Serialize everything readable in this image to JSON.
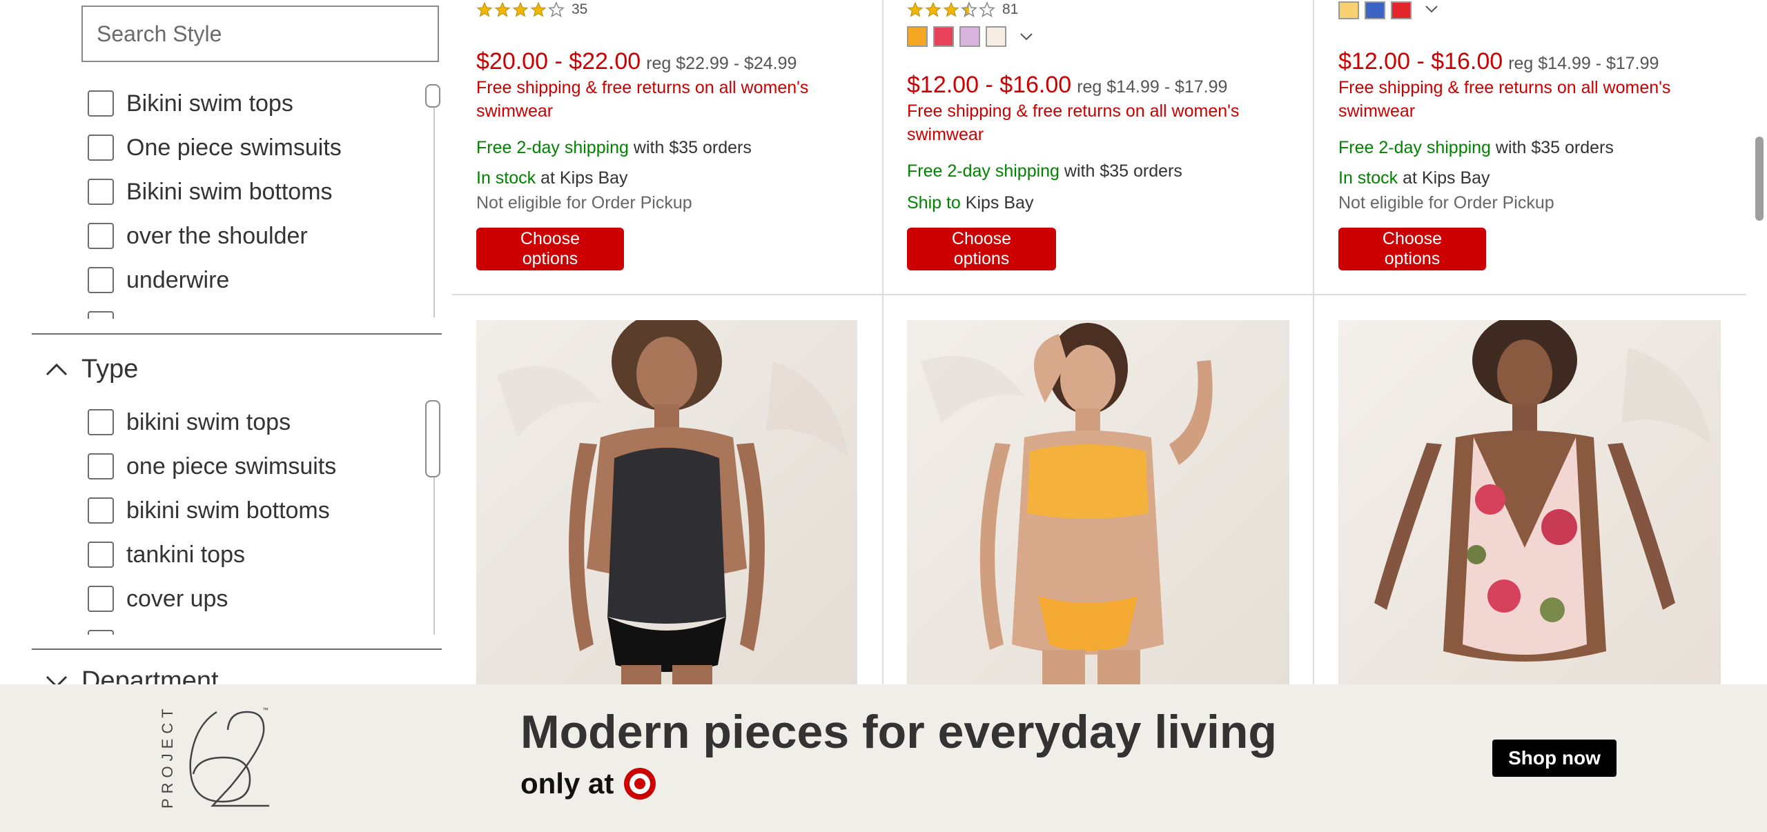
{
  "sidebar": {
    "search_placeholder": "Search Style",
    "style_items": [
      "Bikini swim tops",
      "One piece swimsuits",
      "Bikini swim bottoms",
      "over the shoulder",
      "underwire"
    ],
    "type_section_title": "Type",
    "type_items": [
      "bikini swim tops",
      "one piece swimsuits",
      "bikini swim bottoms",
      "tankini tops",
      "cover ups"
    ],
    "department_section_title": "Department"
  },
  "products_top": [
    {
      "rating_stars": 4,
      "rating_count": "35",
      "price": "$20.00 - $22.00",
      "reg_price": "reg $22.99 - $24.99",
      "promo": "Free shipping & free returns on all women's swimwear",
      "shipping_highlight": "Free 2-day shipping",
      "shipping_rest": " with $35 orders",
      "stock_status": "In stock",
      "stock_rest": " at Kips Bay",
      "pickup_note": "Not eligible for Order Pickup",
      "button_label": "Choose options"
    },
    {
      "rating_stars": 3.5,
      "rating_count": "81",
      "swatch_colors": [
        "#f5a623",
        "#e8415a",
        "#d8b3dd",
        "#f5ece4"
      ],
      "price": "$12.00 - $16.00",
      "reg_price": "reg $14.99 - $17.99",
      "promo": "Free shipping & free returns on all women's swimwear",
      "shipping_highlight": "Free 2-day shipping",
      "shipping_rest": " with $35 orders",
      "stock_status": "Ship to",
      "stock_rest": " Kips Bay",
      "button_label": "Choose options"
    },
    {
      "swatch_colors": [
        "#f7d070",
        "#3b63c4",
        "#e3242b"
      ],
      "price": "$12.00 - $16.00",
      "reg_price": "reg $14.99 - $17.99",
      "promo": "Free shipping & free returns on all women's swimwear",
      "shipping_highlight": "Free 2-day shipping",
      "shipping_rest": " with $35 orders",
      "stock_status": "In stock",
      "stock_rest": " at Kips Bay",
      "pickup_note": "Not eligible for Order Pickup",
      "button_label": "Choose options"
    }
  ],
  "products_bottom": [
    {
      "image": "black-tankini-model-photo"
    },
    {
      "image": "yellow-bandeau-bikini-model-photo"
    },
    {
      "image": "floral-one-piece-model-photo"
    }
  ],
  "banner": {
    "brand": "PROJECT",
    "brand_number": "62",
    "headline": "Modern pieces for everyday living",
    "sub": "only at",
    "button_label": "Shop now"
  },
  "colors": {
    "accent_red": "#cc0000",
    "in_stock_green": "#008300",
    "banner_bg": "#f0eee9",
    "star_gold": "#f2b705"
  }
}
